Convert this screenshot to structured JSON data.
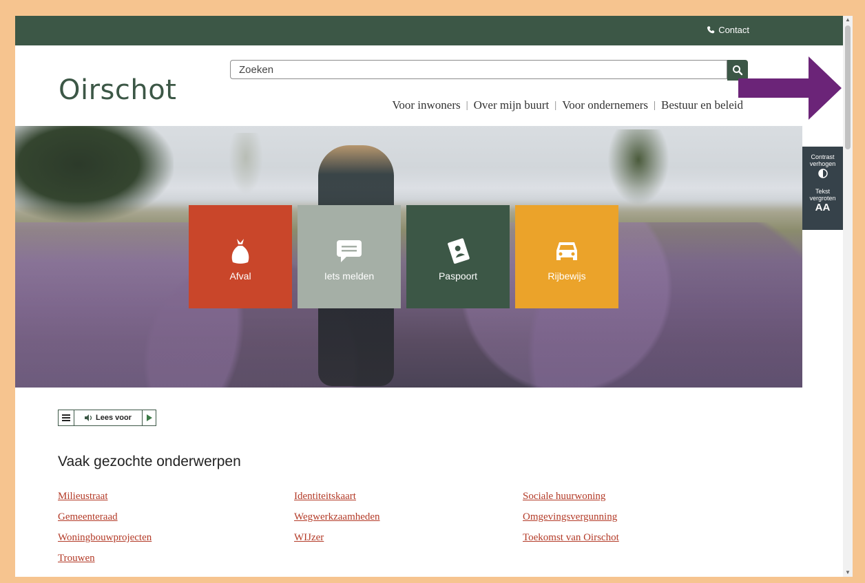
{
  "topbar": {
    "contact_label": "Contact"
  },
  "header": {
    "logo": "Oirschot",
    "search_placeholder": "Zoeken",
    "nav": [
      "Voor inwoners",
      "Over mijn buurt",
      "Voor ondernemers",
      "Bestuur en beleid"
    ]
  },
  "tiles": [
    {
      "label": "Afval",
      "color": "#c9462a",
      "icon": "garbage-bag-icon"
    },
    {
      "label": "Iets melden",
      "color": "#a5afa6",
      "icon": "speech-bubble-icon"
    },
    {
      "label": "Paspoort",
      "color": "#3c5746",
      "icon": "passport-icon"
    },
    {
      "label": "Rijbewijs",
      "color": "#eba32a",
      "icon": "car-icon"
    }
  ],
  "side_tools": {
    "contrast_line1": "Contrast",
    "contrast_line2": "verhogen",
    "text_line1": "Tekst",
    "text_line2": "vergroten",
    "text_icon": "AA"
  },
  "readspeaker": {
    "label": "Lees voor"
  },
  "section": {
    "title": "Vaak gezochte onderwerpen",
    "links": [
      [
        "Milieustraat",
        "Identiteitskaart",
        "Sociale huurwoning"
      ],
      [
        "Gemeenteraad",
        "Wegwerkzaamheden",
        "Omgevingsvergunning"
      ],
      [
        "Woningbouwprojecten",
        "WIJzer",
        "Toekomst van Oirschot"
      ],
      [
        "Trouwen"
      ]
    ]
  },
  "colors": {
    "brand_green": "#3c5746",
    "link_red": "#b33a27",
    "frame": "#f6c48f",
    "annotation_arrow": "#6b2478"
  }
}
